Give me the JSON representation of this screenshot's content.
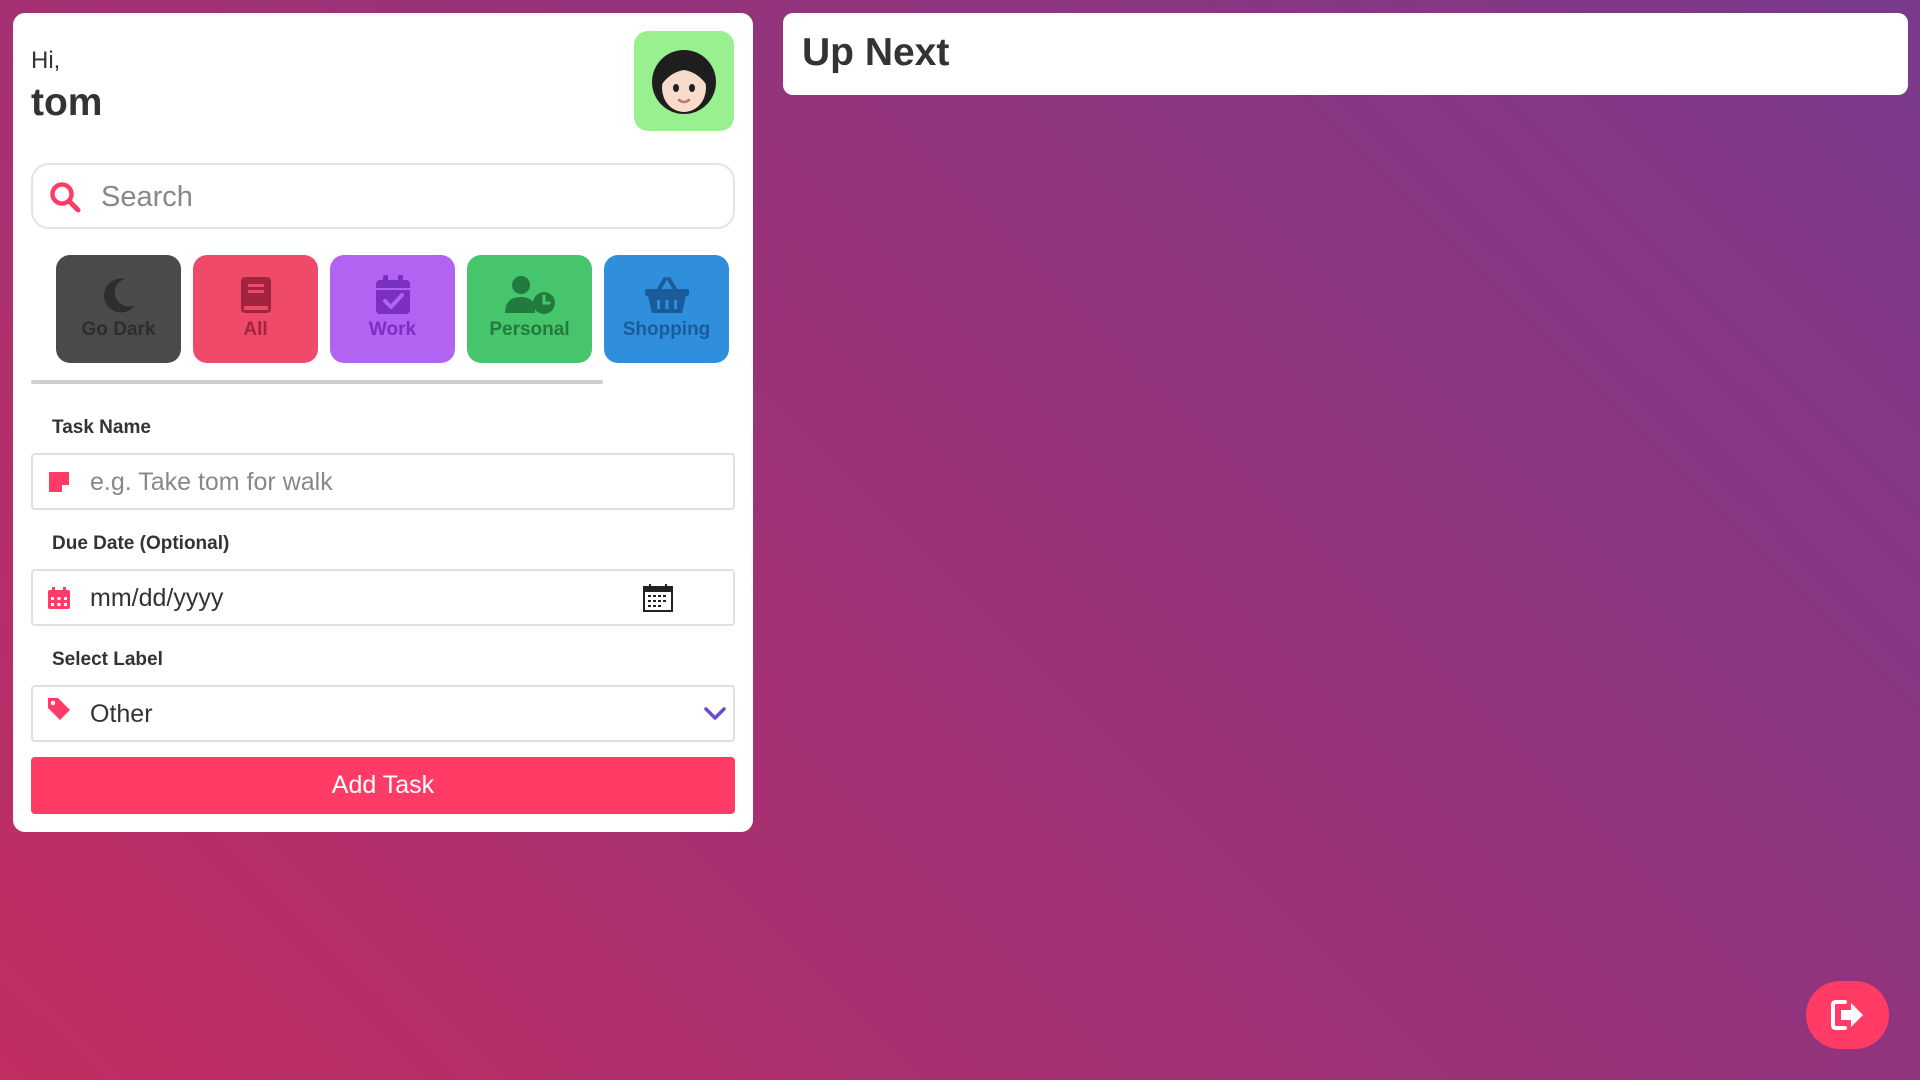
{
  "greeting": {
    "hi": "Hi,",
    "name": "tom"
  },
  "avatar": {
    "icon": "woman-face-avatar",
    "bg": "#98f08f"
  },
  "search": {
    "placeholder": "Search",
    "icon": "search-icon"
  },
  "categories": [
    {
      "label": "Go Dark",
      "icon": "moon-icon",
      "bg": "#4a4a4a",
      "fg": "#2d2d2d"
    },
    {
      "label": "All",
      "icon": "book-icon",
      "bg": "#ef4a6a",
      "fg": "#a3243f"
    },
    {
      "label": "Work",
      "icon": "calendar-check-icon",
      "bg": "#b263f2",
      "fg": "#7a30c0"
    },
    {
      "label": "Personal",
      "icon": "user-clock-icon",
      "bg": "#47c56c",
      "fg": "#237a3e"
    },
    {
      "label": "Shopping",
      "icon": "basket-icon",
      "bg": "#2f8fdc",
      "fg": "#1a5c9a"
    }
  ],
  "form": {
    "task_name": {
      "label": "Task Name",
      "placeholder": "e.g. Take tom for walk"
    },
    "due_date": {
      "label": "Due Date (Optional)",
      "value": "mm/dd/yyyy"
    },
    "select_label": {
      "label": "Select Label",
      "value": "Other"
    },
    "add_button": "Add Task"
  },
  "up_next": {
    "title": "Up Next"
  },
  "colors": {
    "accent": "#ff3b66",
    "chevron": "#6b4bd1"
  }
}
